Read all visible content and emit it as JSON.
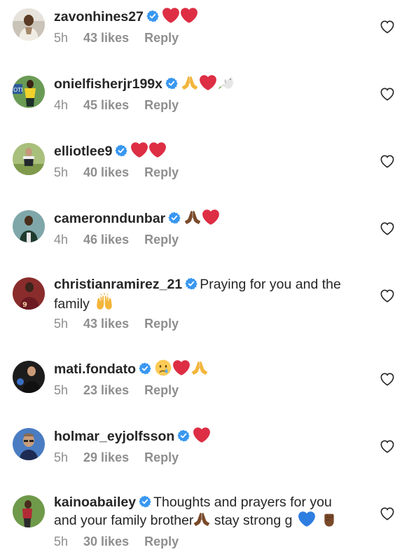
{
  "comments": [
    {
      "username": "zavonhines27",
      "text": "",
      "time": "5h",
      "likes": "43 likes",
      "reply": "Reply",
      "emojis": [
        "red-heart",
        "red-heart"
      ]
    },
    {
      "username": "onielfisherjr199x",
      "text": "",
      "time": "4h",
      "likes": "45 likes",
      "reply": "Reply",
      "emojis": [
        "folded-hands",
        "red-heart",
        "dove"
      ]
    },
    {
      "username": "elliotlee9",
      "text": "",
      "time": "5h",
      "likes": "40 likes",
      "reply": "Reply",
      "emojis": [
        "red-heart",
        "red-heart"
      ]
    },
    {
      "username": "cameronndunbar",
      "text": "",
      "time": "4h",
      "likes": "46 likes",
      "reply": "Reply",
      "emojis": [
        "folded-hands-dark",
        "red-heart"
      ]
    },
    {
      "username": "christianramirez_21",
      "text": "Praying for you and the",
      "text2": "family",
      "time": "5h",
      "likes": "43 likes",
      "reply": "Reply",
      "emojis": [
        "raised-hands"
      ]
    },
    {
      "username": "mati.fondato",
      "text": "",
      "time": "5h",
      "likes": "23 likes",
      "reply": "Reply",
      "emojis": [
        "crying-face",
        "red-heart",
        "folded-hands"
      ]
    },
    {
      "username": "holmar_eyjolfsson",
      "text": "",
      "time": "5h",
      "likes": "29 likes",
      "reply": "Reply",
      "emojis": [
        "red-heart"
      ]
    },
    {
      "username": "kainoabailey",
      "text": "Thoughts and prayers for you",
      "text2": "and your family brother",
      "text3": "stay strong g",
      "time": "5h",
      "likes": "30 likes",
      "reply": "Reply",
      "emojis": [
        "folded-hands-dark",
        "blue-heart",
        "raised-fist-dark"
      ]
    }
  ],
  "colors": {
    "username": "#262626",
    "meta": "#8e8e8e",
    "verified": "#3897f0",
    "heart_emoji": "#e0245e",
    "like_outline": "#8e8e8e"
  }
}
